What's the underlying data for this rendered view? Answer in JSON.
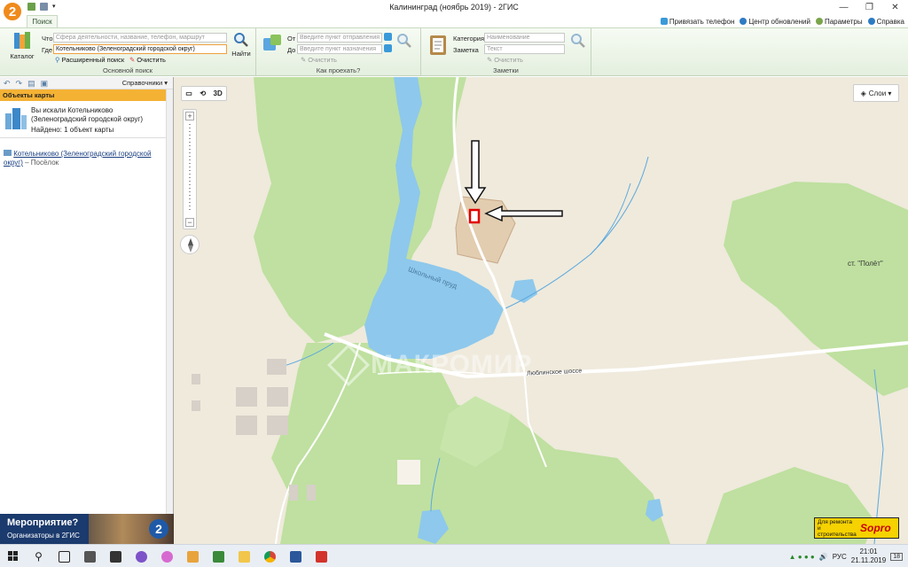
{
  "app": {
    "title": "Калининград (ноябрь 2019) - 2ГИС",
    "logo": "2",
    "window_controls": [
      "—",
      "❐",
      "✕"
    ]
  },
  "tabs": {
    "search": "Поиск"
  },
  "top_links": {
    "link_phone": "Привязать телефон",
    "updates": "Центр обновлений",
    "settings": "Параметры",
    "help": "Справка"
  },
  "main_search": {
    "catalog": "Каталог",
    "what_label": "Что",
    "what_placeholder": "Сфера деятельности, название, телефон, маршрут",
    "where_label": "Где",
    "where_value": "Котельниково (Зеленоградский городской округ)",
    "find": "Найти",
    "advanced": "Расширенный поиск",
    "clear": "Очистить",
    "group_label": "Основной поиск"
  },
  "route": {
    "from_label": "От",
    "from_placeholder": "Введите пункт отправления",
    "to_label": "До",
    "to_placeholder": "Введите пункт назначения",
    "clear": "Очистить",
    "group_label": "Как проехать?"
  },
  "notes": {
    "category_label": "Категория",
    "category_placeholder": "Наименование",
    "note_label": "Заметка",
    "note_placeholder": "Текст",
    "clear": "Очистить",
    "group_label": "Заметки"
  },
  "sidebar": {
    "references": "Справочники ▾",
    "header": "Объекты карты",
    "searched_line1": "Вы искали Котельниково",
    "searched_line2": "(Зеленоградский городской округ)",
    "found": "Найдено: 1 объект карты",
    "result_link": "Котельниково (Зеленоградский городской округ)",
    "result_type": " – Посёлок"
  },
  "ad": {
    "title": "Мероприятие?",
    "subtitle": "Организаторы в 2ГИС",
    "badge": "2"
  },
  "map": {
    "layers": "Слои ▾",
    "mode_3d": "3D",
    "pond_label": "Школьный пруд",
    "road_label": "Люблинское шоссе",
    "station_label": "ст. \"Полёт\"",
    "watermark": "МАКРОМИР",
    "sopro_text": "Для ремонта и строительства",
    "sopro_brand": "Sopro"
  },
  "taskbar": {
    "lang": "РУС",
    "time": "21:01",
    "date": "21.11.2019",
    "notify": "18"
  }
}
